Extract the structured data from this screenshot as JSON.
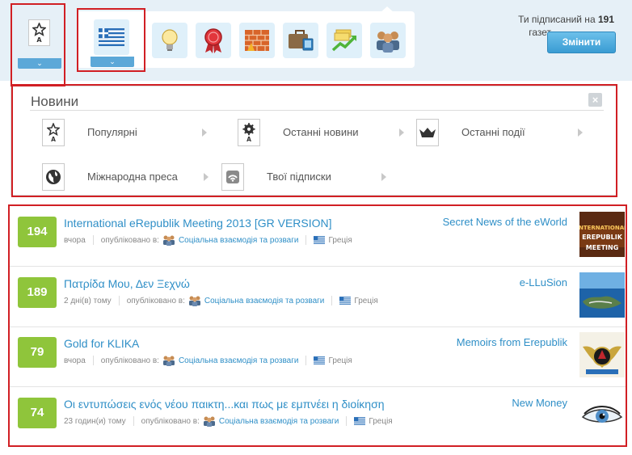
{
  "filters": {
    "popular_icon": "star-a-icon",
    "country_flag": "greece-flag-icon",
    "categories": [
      {
        "name": "lightbulb-icon"
      },
      {
        "name": "ribbon-icon"
      },
      {
        "name": "brick-wall-icon"
      },
      {
        "name": "briefcase-icon"
      },
      {
        "name": "money-growth-icon"
      },
      {
        "name": "people-icon"
      }
    ]
  },
  "subscription": {
    "text_before": "Ти підписаний на",
    "count": "191",
    "text_after": "газет",
    "change_label": "Змінити"
  },
  "menu": {
    "title": "Новини",
    "close": "×",
    "items": [
      {
        "label": "Популярні",
        "icon": "star-a-icon"
      },
      {
        "label": "Останні новини",
        "icon": "gear-a-icon"
      },
      {
        "label": "Останні події",
        "icon": "battle-icon"
      },
      {
        "label": "Міжнародна преса",
        "icon": "globe-icon"
      },
      {
        "label": "Твої підписки",
        "icon": "rss-icon"
      }
    ]
  },
  "articles": [
    {
      "votes": "194",
      "title": "International eRepublik Meeting 2013 [GR VERSION]",
      "time": "вчора",
      "published_in": "опубліковано в:",
      "category": "Соціальна взаємодія та розваги",
      "country": "Греція",
      "newspaper": "Secret News of the eWorld",
      "avatar": "meeting-logo"
    },
    {
      "votes": "189",
      "title": "Πατρίδα Μου, Δεν Ξεχνώ",
      "time": "2 дні(в) тому",
      "published_in": "опубліковано в:",
      "category": "Соціальна взаємодія та розваги",
      "country": "Греція",
      "newspaper": "e-LLuSion",
      "avatar": "island-logo"
    },
    {
      "votes": "79",
      "title": "Gold for KLIKA",
      "time": "вчора",
      "published_in": "опубліковано в:",
      "category": "Соціальна взаємодія та розваги",
      "country": "Греція",
      "newspaper": "Memoirs from Erepublik",
      "avatar": "wings-emblem"
    },
    {
      "votes": "74",
      "title": "Οι εντυπώσεις ενός νέου παικτη...και πως με εμπνέει η διοίκηση",
      "time": "23 годин(и) тому",
      "published_in": "опубліковано в:",
      "category": "Соціальна взаємодія та розваги",
      "country": "Греція",
      "newspaper": "New Money",
      "avatar": "eye-logo"
    }
  ],
  "colors": {
    "accent": "#2f8fc7",
    "votes": "#8fc53b",
    "highlight": "#d11f24"
  }
}
